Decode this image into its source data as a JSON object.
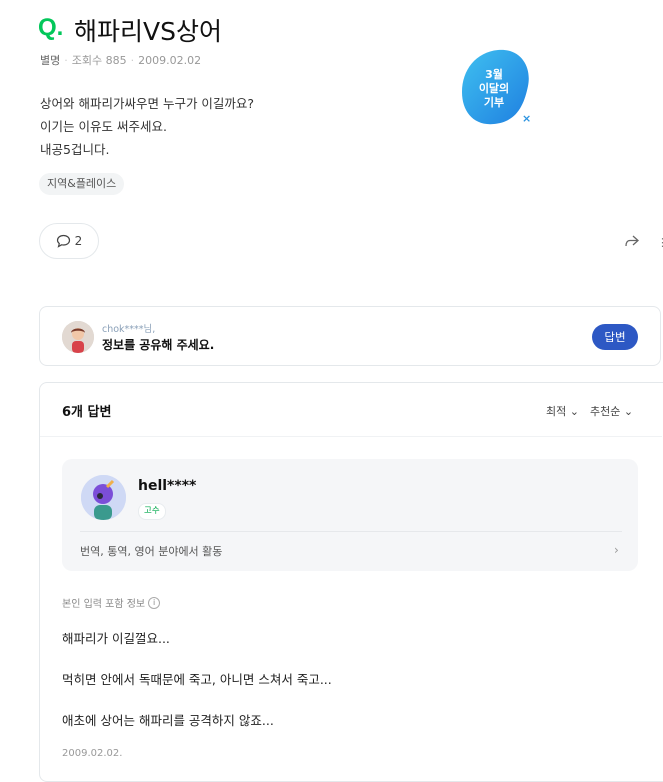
{
  "question": {
    "mark": "Q.",
    "title": "해파리VS상어",
    "author": "별명",
    "views": "조회수 885",
    "date": "2009.02.02",
    "body": [
      "상어와 해파리가싸우면 누구가 이길까요?",
      "이기는 이유도 써주세요.",
      "내공5겁니다."
    ],
    "tag": "지역&플레이스",
    "comment_count": "2"
  },
  "promo": {
    "line1": "3월",
    "line2": "이달의",
    "line3": "기부",
    "close": "×"
  },
  "prompt": {
    "user": "chok****님,",
    "message": "정보를 공유해 주세요.",
    "answer_button": "답변"
  },
  "answers": {
    "count_label": "6개 답변",
    "sort_latest": "최적",
    "sort_recommend": "추천순",
    "first": {
      "user": "hell****",
      "badge": "고수",
      "field": "번역, 통역, 영어 분야에서 활동",
      "info": "본인 입력 포함 정보",
      "lines": [
        "해파리가 이길껄요...",
        "먹히면 안에서 독때문에 죽고, 아니면 스쳐서 죽고...",
        "애초에 상어는 해파리를 공격하지 않죠..."
      ],
      "date": "2009.02.02."
    }
  },
  "colors": {
    "brand_green": "#03c75a",
    "answer_blue": "#2d58c4",
    "promo_blue": "#2b93e0"
  }
}
